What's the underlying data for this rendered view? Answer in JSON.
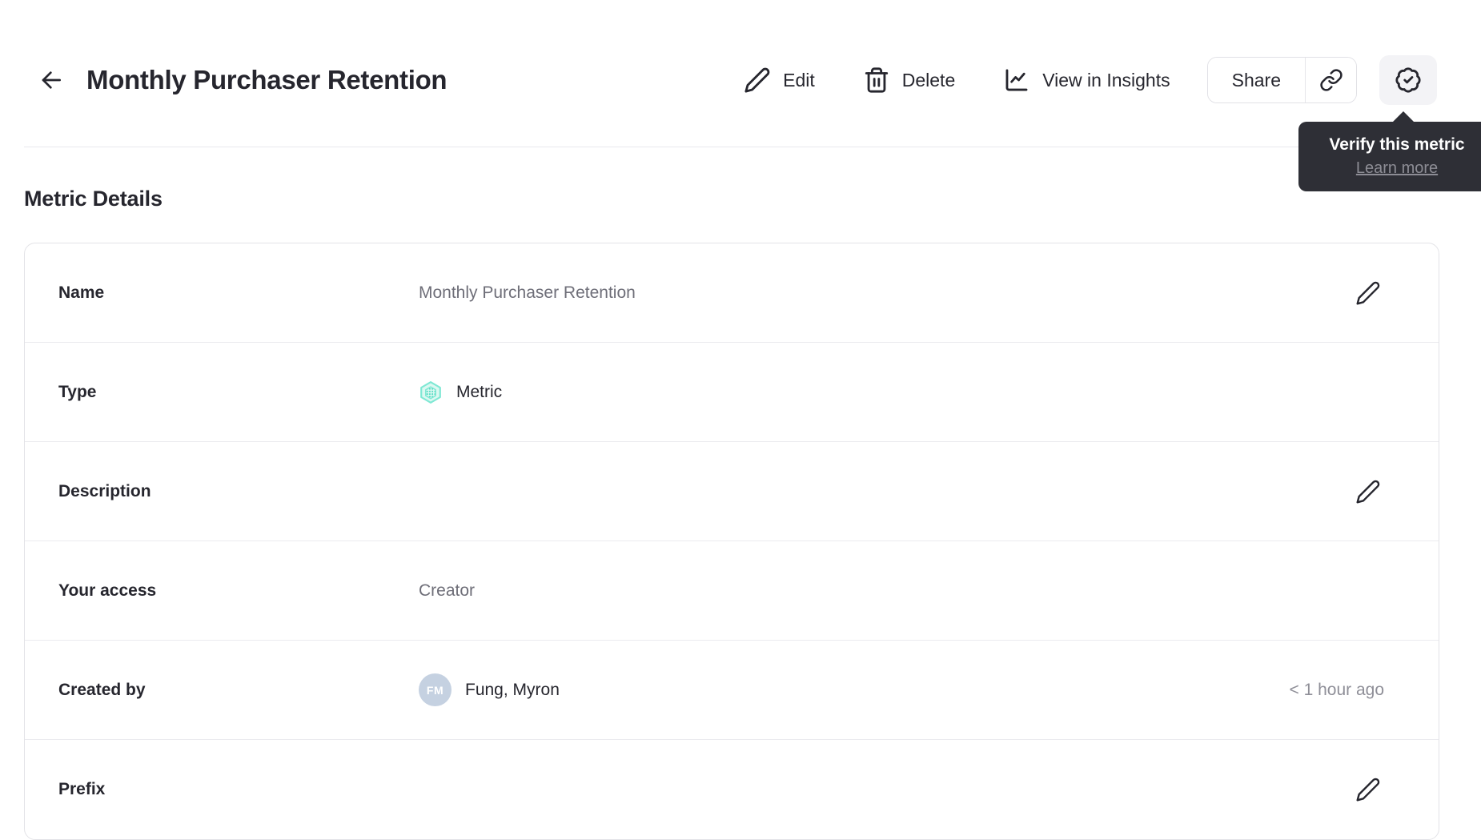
{
  "header": {
    "title": "Monthly Purchaser Retention",
    "edit_label": "Edit",
    "delete_label": "Delete",
    "insights_label": "View in Insights",
    "share_label": "Share"
  },
  "verify_tooltip": {
    "title": "Verify this metric",
    "link_label": "Learn more"
  },
  "section_heading": "Metric Details",
  "rows": {
    "name": {
      "label": "Name",
      "value": "Monthly Purchaser Retention"
    },
    "type": {
      "label": "Type",
      "value": "Metric"
    },
    "description": {
      "label": "Description",
      "value": ""
    },
    "access": {
      "label": "Your access",
      "value": "Creator"
    },
    "created_by": {
      "label": "Created by",
      "avatar_initials": "FM",
      "value": "Fung, Myron",
      "timestamp": "< 1 hour ago"
    },
    "prefix": {
      "label": "Prefix",
      "value": ""
    }
  },
  "icons": {
    "back": "arrow-left-icon",
    "edit": "pencil-icon",
    "delete": "trash-icon",
    "insights": "line-chart-icon",
    "copy_link": "link-icon",
    "verify": "verified-badge-icon",
    "metric_type": "hexagon-metric-icon"
  },
  "colors": {
    "text_dark": "#26262e",
    "text_gray": "#6e6e78",
    "timestamp_gray": "#8f8f98",
    "divider": "#ebebef",
    "card_border": "#e3e3e7",
    "tooltip_bg": "#2e2f36",
    "tooltip_link": "#8d8d95",
    "badge_button_bg": "#f3f3f6",
    "metric_icon_fill": "#dcf8f1",
    "metric_icon_stroke": "#7fe8d4",
    "metric_icon_inner": "#2fd3b5",
    "avatar_bg": "#c5d1e1"
  }
}
